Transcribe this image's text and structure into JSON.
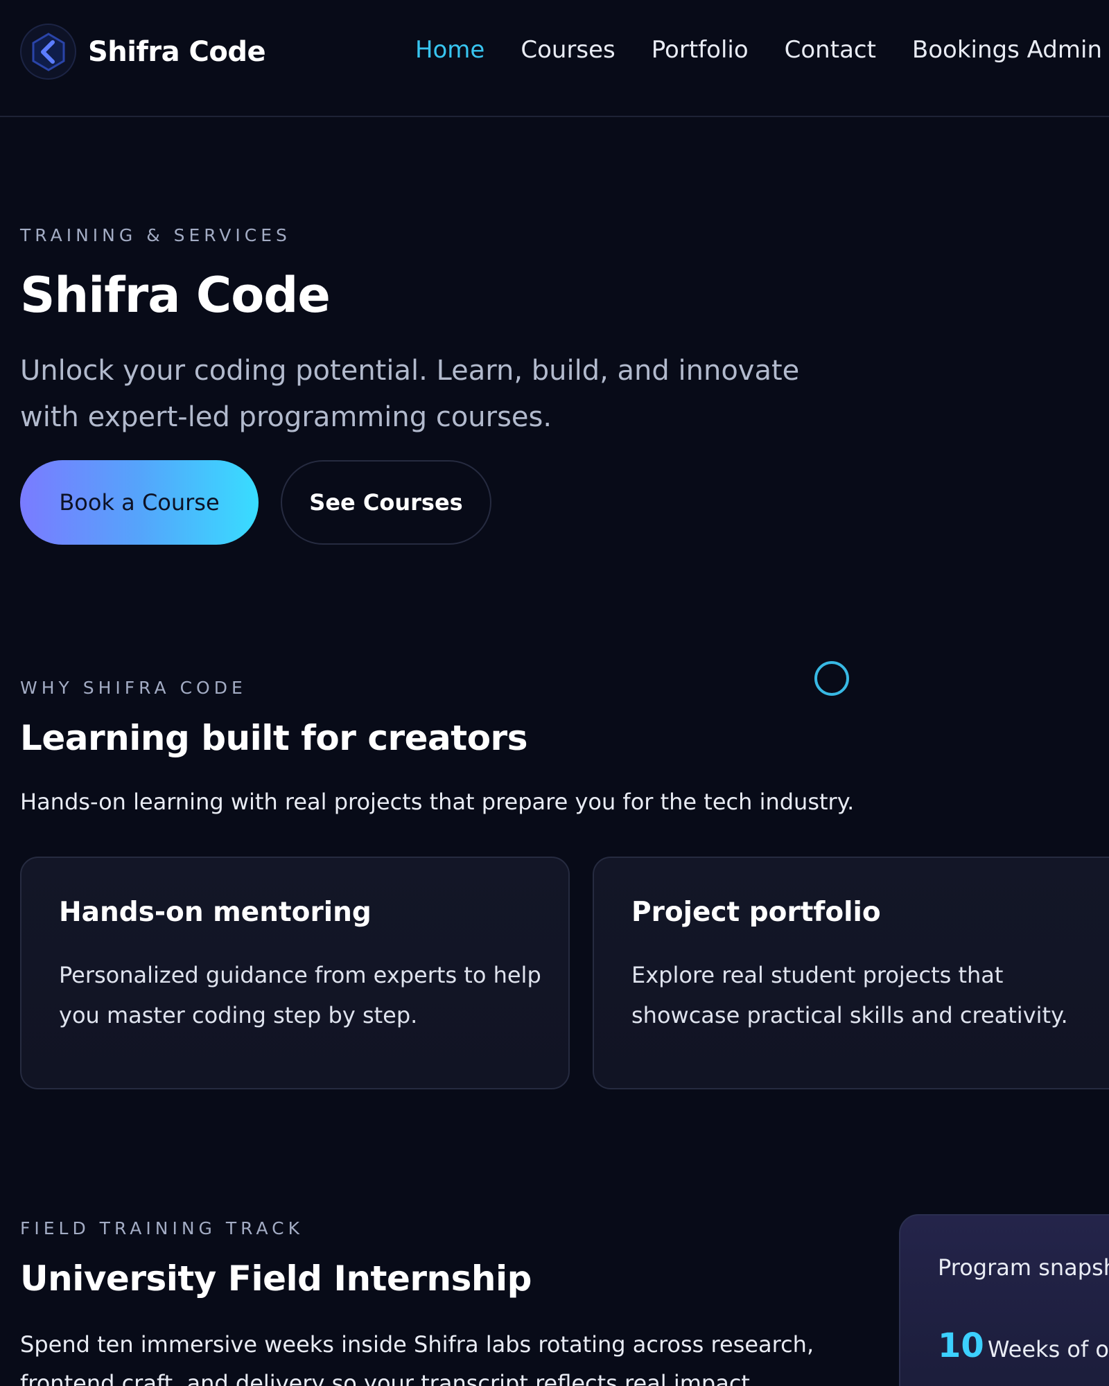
{
  "nav": {
    "brand": "Shifra Code",
    "links": [
      "Home",
      "Courses",
      "Portfolio",
      "Contact",
      "Bookings Admin"
    ]
  },
  "hero": {
    "eyebrow": "TRAINING & SERVICES",
    "title": "Shifra Code",
    "subtitle": "Unlock your coding potential. Learn, build, and innovate with expert-led programming courses.",
    "primary_button": "Book a Course",
    "secondary_button": "See Courses"
  },
  "why": {
    "eyebrow": "WHY SHIFRA CODE",
    "title": "Learning built for creators",
    "subtitle": "Hands-on learning with real projects that prepare you for the tech industry.",
    "cards": [
      {
        "title": "Hands-on mentoring",
        "body": "Personalized guidance from experts to help you master coding step by step."
      },
      {
        "title": "Project portfolio",
        "body": "Explore real student projects that showcase practical skills and creativity."
      }
    ]
  },
  "internship": {
    "eyebrow": "FIELD TRAINING TRACK",
    "title": "University Field Internship",
    "description": "Spend ten immersive weeks inside Shifra labs rotating across research, frontend craft, and delivery so your transcript reflects real impact.",
    "snapshot": {
      "label": "Program snapsh",
      "stat_value": "10",
      "stat_label": "Weeks of o"
    }
  },
  "colors": {
    "background": "#080b18",
    "accent": "#38c5f0",
    "button_gradient_start": "#7a7bff",
    "button_gradient_end": "#38ddff"
  },
  "icons": {
    "logo": "chevron-left-badge-icon",
    "decorative_ring": "ring-icon"
  }
}
